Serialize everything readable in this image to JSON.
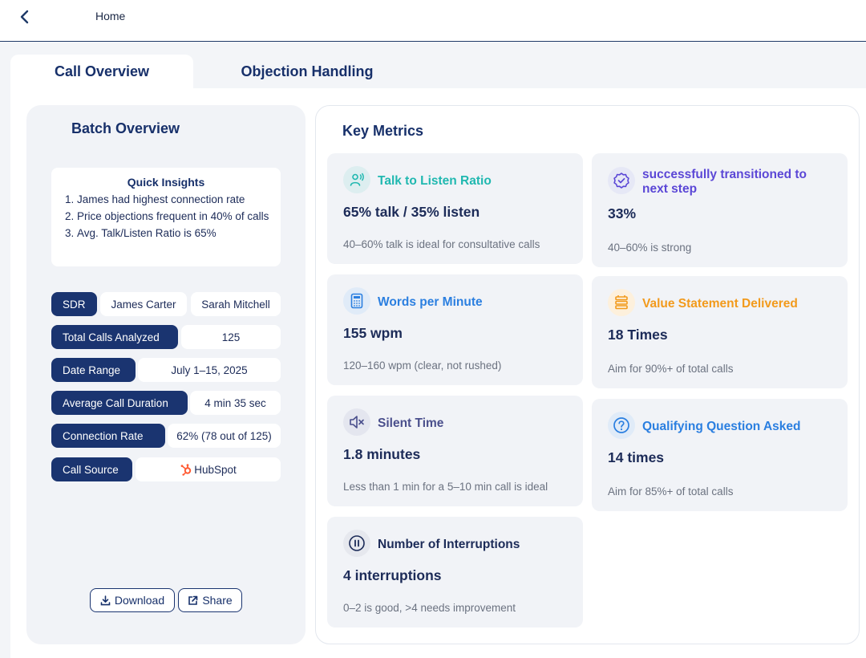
{
  "header": {
    "home_label": "Home"
  },
  "tabs": [
    {
      "label": "Call Overview",
      "active": true
    },
    {
      "label": "Objection Handling",
      "active": false
    }
  ],
  "batch": {
    "title": "Batch Overview",
    "insights": {
      "title": "Quick Insights",
      "items": [
        "James had highest connection rate",
        "Price objections frequent in 40% of calls",
        "Avg. Talk/Listen Ratio is 65%"
      ]
    },
    "sdr": {
      "label": "SDR",
      "names": [
        "James Carter",
        "Sarah Mitchell"
      ]
    },
    "fields": [
      {
        "label": "Total Calls Analyzed",
        "value": "125"
      },
      {
        "label": "Date Range",
        "value": "July 1–15, 2025"
      },
      {
        "label": "Average Call Duration",
        "value": "4 min 35 sec"
      },
      {
        "label": "Connection Rate",
        "value": "62% (78 out of 125)"
      },
      {
        "label": "Call Source",
        "value": "HubSpot"
      }
    ],
    "actions": {
      "download": "Download",
      "share": "Share"
    }
  },
  "key_metrics": {
    "title": "Key Metrics",
    "items": [
      {
        "icon": "speaking-person-icon",
        "title": "Talk to Listen Ratio",
        "value": "65% talk / 35% listen",
        "note": "40–60% talk is ideal for consultative calls",
        "color": "#20b8b0"
      },
      {
        "icon": "verified-badge-icon",
        "title": "successfully transitioned to next step",
        "value": "33%",
        "note": "40–60% is strong",
        "color": "#5b47d6"
      },
      {
        "icon": "calculator-icon",
        "title": "Words per Minute",
        "value": "155 wpm",
        "note": "120–160 wpm (clear, not rushed)",
        "color": "#2b7fe0"
      },
      {
        "icon": "stack-icon",
        "title": "Value Statement Delivered",
        "value": "18 Times",
        "note": "Aim for 90%+ of total calls",
        "color": "#f29a1c"
      },
      {
        "icon": "mute-speaker-icon",
        "title": "Silent Time",
        "value": "1.8 minutes",
        "note": "Less than 1 min for a 5–10 min call is ideal",
        "color": "#4a4f8c"
      },
      {
        "icon": "question-circle-icon",
        "title": "Qualifying Question Asked",
        "value": "14 times",
        "note": "Aim for 85%+ of total calls",
        "color": "#2b7fe0"
      },
      {
        "icon": "pause-circle-icon",
        "title": "Number of Interruptions",
        "value": "4 interruptions",
        "note": "0–2 is good, >4 needs improvement",
        "color": "#1c2b58"
      }
    ]
  },
  "colors": {
    "navy": "#1a3470",
    "hubspot": "#ff5c35"
  }
}
